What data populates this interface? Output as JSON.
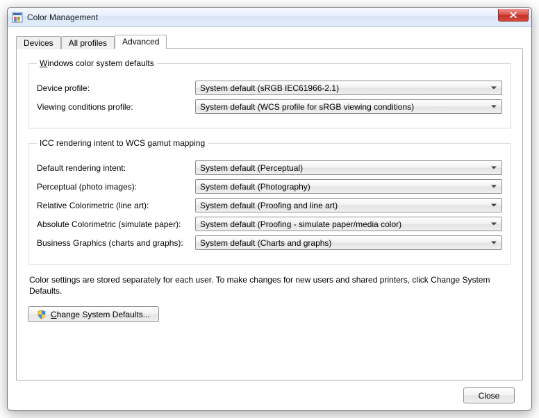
{
  "window": {
    "title": "Color Management"
  },
  "tabs": {
    "devices": "Devices",
    "all_profiles": "All profiles",
    "advanced": "Advanced"
  },
  "wcs_defaults": {
    "legend_pre": "W",
    "legend_post": "indows color system defaults",
    "device_profile_label": "Device profile:",
    "device_profile_value": "System default (sRGB IEC61966-2.1)",
    "viewing_label": "Viewing conditions profile:",
    "viewing_value": "System default (WCS profile for sRGB viewing conditions)"
  },
  "icc": {
    "legend": "ICC  rendering intent to WCS gamut mapping",
    "default_intent_label": "Default rendering intent:",
    "default_intent_value": "System default (Perceptual)",
    "perceptual_label": "Perceptual (photo images):",
    "perceptual_value": "System default (Photography)",
    "relcol_label": "Relative Colorimetric (line art):",
    "relcol_value": "System default (Proofing and line art)",
    "abscol_label": "Absolute Colorimetric (simulate paper):",
    "abscol_value": "System default (Proofing - simulate paper/media color)",
    "biz_label": "Business Graphics (charts and graphs):",
    "biz_value": "System default (Charts and graphs)"
  },
  "note": "Color settings are stored separately for each user. To make changes for new users and shared printers, click Change System Defaults.",
  "change_defaults_pre": "C",
  "change_defaults_post": "hange System Defaults...",
  "close": "Close"
}
